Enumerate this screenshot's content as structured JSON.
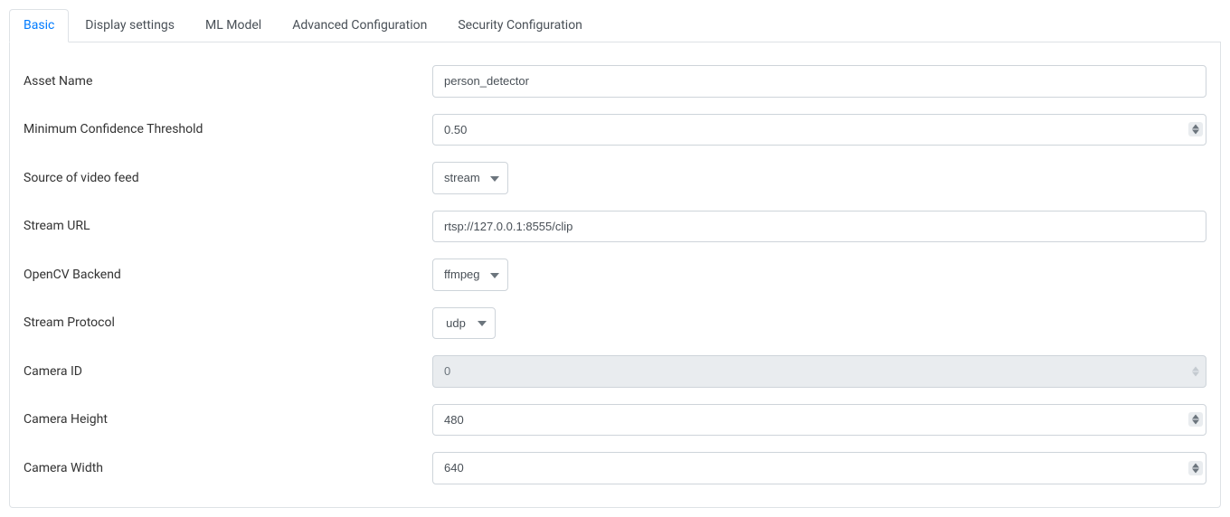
{
  "tabs": [
    {
      "label": "Basic",
      "active": true
    },
    {
      "label": "Display settings",
      "active": false
    },
    {
      "label": "ML Model",
      "active": false
    },
    {
      "label": "Advanced Configuration",
      "active": false
    },
    {
      "label": "Security Configuration",
      "active": false
    }
  ],
  "form": {
    "asset_name": {
      "label": "Asset Name",
      "value": "person_detector"
    },
    "min_confidence": {
      "label": "Minimum Confidence Threshold",
      "value": "0.50"
    },
    "video_source": {
      "label": "Source of video feed",
      "value": "stream"
    },
    "stream_url": {
      "label": "Stream URL",
      "value": "rtsp://127.0.0.1:8555/clip"
    },
    "opencv_backend": {
      "label": "OpenCV Backend",
      "value": "ffmpeg"
    },
    "stream_protocol": {
      "label": "Stream Protocol",
      "value": "udp"
    },
    "camera_id": {
      "label": "Camera ID",
      "value": "0"
    },
    "camera_height": {
      "label": "Camera Height",
      "value": "480"
    },
    "camera_width": {
      "label": "Camera Width",
      "value": "640"
    }
  }
}
